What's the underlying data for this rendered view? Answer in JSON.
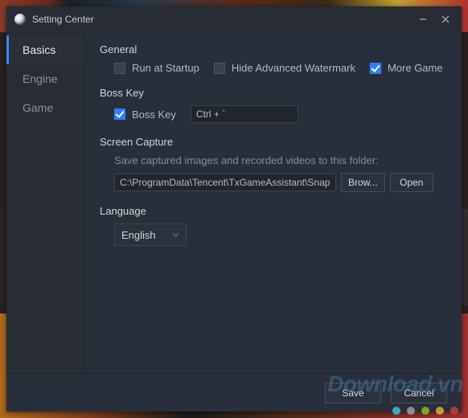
{
  "title": "Setting Center",
  "tabs": {
    "basics": "Basics",
    "engine": "Engine",
    "game": "Game"
  },
  "general": {
    "heading": "General",
    "run_startup": "Run at Startup",
    "hide_watermark": "Hide Advanced Watermark",
    "more_game": "More Game"
  },
  "bosskey": {
    "heading": "Boss Key",
    "label": "Boss Key",
    "value": "Ctrl + `"
  },
  "capture": {
    "heading": "Screen Capture",
    "desc": "Save captured images and recorded videos to this folder:",
    "path": "C:\\ProgramData\\Tencent\\TxGameAssistant\\Snapshot",
    "browse": "Brow...",
    "open": "Open"
  },
  "language": {
    "heading": "Language",
    "selected": "English"
  },
  "footer": {
    "save": "Save",
    "cancel": "Cancel"
  },
  "watermark": "Download.vn"
}
